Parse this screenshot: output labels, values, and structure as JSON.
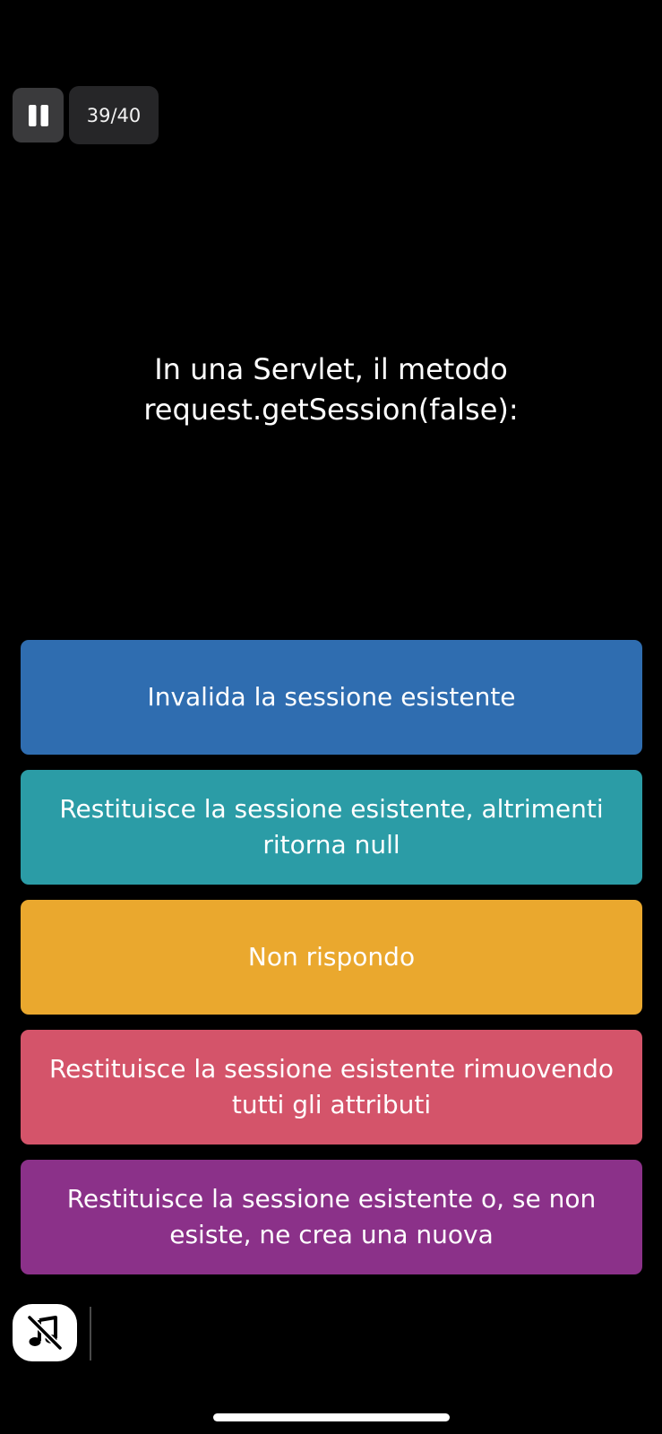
{
  "header": {
    "pause_icon": "pause-icon",
    "progress": "39/40"
  },
  "question": {
    "text": "In una Servlet, il metodo request.getSession(false):"
  },
  "answers": [
    {
      "label": "Invalida la sessione esistente",
      "color": "#2f6db0"
    },
    {
      "label": "Restituisce la sessione esistente, altrimenti ritorna null",
      "color": "#2b9ca6"
    },
    {
      "label": "Non rispondo",
      "color": "#eaa82e"
    },
    {
      "label": "Restituisce la sessione esistente rimuovendo tutti gli attributi",
      "color": "#d4546a"
    },
    {
      "label": "Restituisce la sessione esistente o, se non esiste, ne crea una nuova",
      "color": "#8b3189"
    }
  ],
  "footer": {
    "mute_icon": "music-off-icon"
  }
}
